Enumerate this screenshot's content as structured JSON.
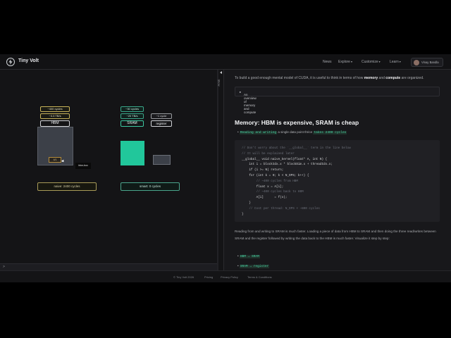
{
  "nav": {
    "brand": "Tiny Volt",
    "items": [
      "News",
      "Explore",
      "Customize",
      "Learn"
    ],
    "user": "Vinay Bandla"
  },
  "viz": {
    "hbm": {
      "label": "HBM",
      "latency": "~400 cycles",
      "bandwidth": "~3.3 TB/s",
      "cell": "4/1",
      "tooltip": "hbm-box",
      "button": "naive: 2400 cycles"
    },
    "sram": {
      "label": "SRAM",
      "latency": "~30 cycles",
      "bandwidth": "~20 TB/s",
      "button": "smart: 0 cycles"
    },
    "register": {
      "label": "register",
      "latency": "~1 cycle"
    }
  },
  "input_prompt": ">",
  "sidetab": "Show",
  "article": {
    "intro_pre": "To build a good enough mental model of CUDA, it is useful to think in terms of how ",
    "intro_mem": "memory",
    "intro_and": " and ",
    "intro_comp": "compute",
    "intro_post": " are organized.",
    "details_label": "An overview of memory and compute",
    "heading": "Memory: HBM is expensive, SRAM is cheap",
    "bullet_code1": "Reading and writing",
    "bullet_mid": " a single data point thrice ",
    "bullet_code2": "takes 2400 cycles",
    "code": [
      "// Don't worry about the `__global__` term in the line below",
      "// It will be explained later",
      "__global__ void naive_kernel(float* A, int N) {",
      "    int i = blockIdx.x * blockDim.x + threadIdx.x;",
      "    if (i >= N) return;",
      "    for (int k = 0; k < N_OPS; k++) {",
      "        // ~400 cycles from HBM",
      "        float x = A[i];",
      "        // ~400 cycles back to HBM",
      "        A[i]      = f(x);",
      "    }",
      "    // Cost per thread: N_OPS × ~800 cycles",
      "}"
    ],
    "paragraph": "Reading from and writing to SRAM is much faster. Loading a piece of data from HBM to SRAM and then doing the three read/writes between SRAM and the register followed by writing the data back to the HBM is much faster. Visualize it step by step:",
    "list": [
      "HBM → SRAM",
      "SRAM → register"
    ]
  },
  "footer": [
    "© Tiny Volt 2026",
    "Pricing",
    "Privacy Policy",
    "Terms & Conditions"
  ]
}
